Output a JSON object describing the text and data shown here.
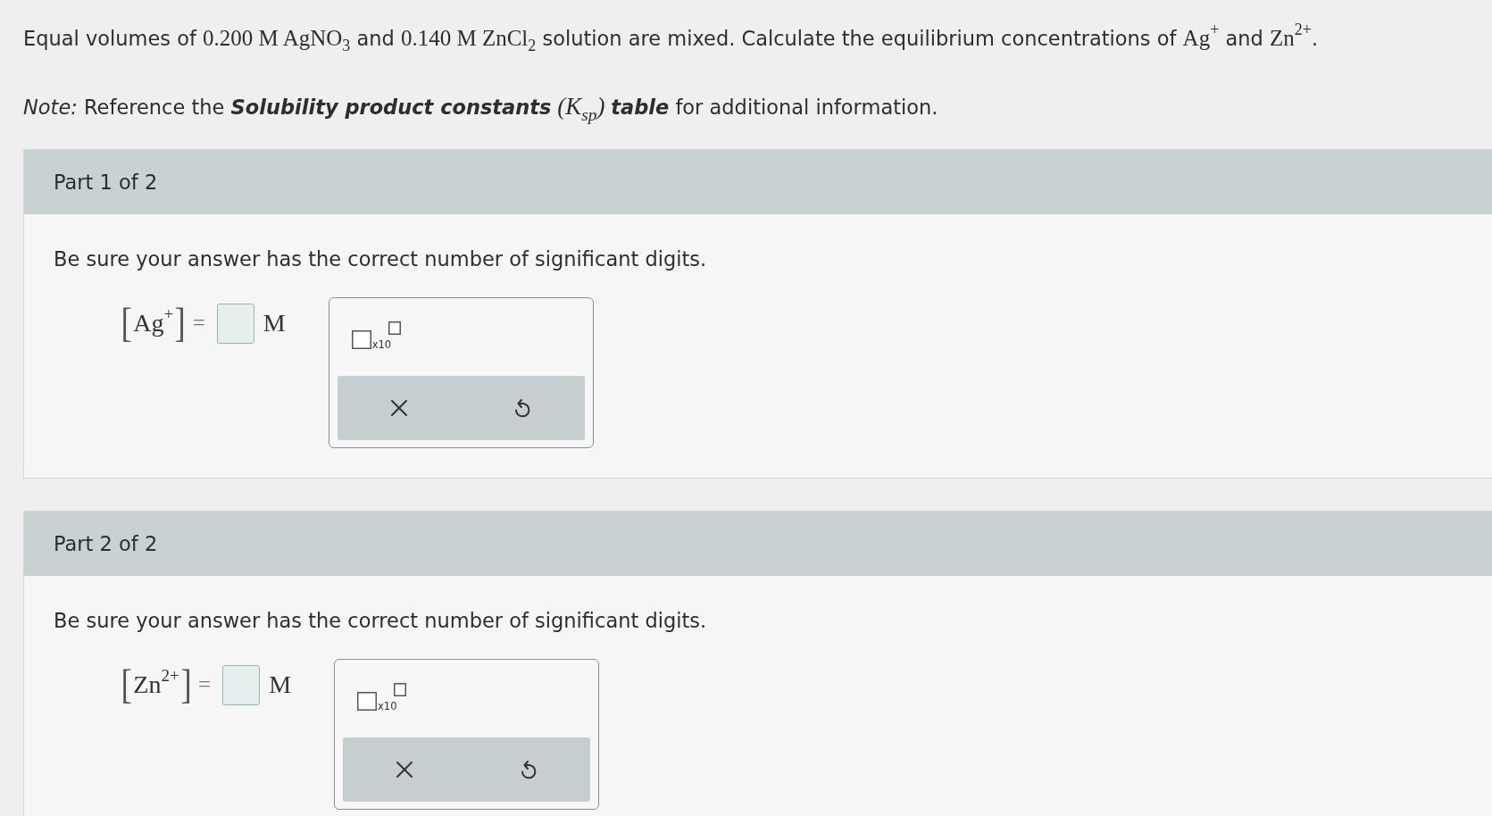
{
  "question": {
    "segments": [
      {
        "kind": "text",
        "text": "Equal volumes of "
      },
      {
        "kind": "math",
        "text": "0.200 M AgNO$_{3}$"
      },
      {
        "kind": "text",
        "text": " and "
      },
      {
        "kind": "math",
        "text": "0.140 M ZnCl$_{2}$"
      },
      {
        "kind": "text",
        "text": " solution are mixed. Calculate the equilibrium concentrations of "
      },
      {
        "kind": "math",
        "text": "Ag$^{+}$"
      },
      {
        "kind": "text",
        "text": " and "
      },
      {
        "kind": "math",
        "text": "Zn$^{2+}$"
      },
      {
        "kind": "text",
        "text": "."
      }
    ]
  },
  "note": {
    "segments": [
      {
        "kind": "text",
        "text": "*Note:* Reference the "
      },
      {
        "kind": "emphasis",
        "text": "Solubility product constants"
      },
      {
        "kind": "math_italic",
        "text": " (K$_{sp}$) "
      },
      {
        "kind": "emphasis",
        "text": "table"
      },
      {
        "kind": "text",
        "text": " for additional information."
      }
    ]
  },
  "parts": [
    {
      "title": "Part 1 of 2",
      "instruction": "Be sure your answer has the correct number of significant digits.",
      "equation": {
        "open": "[",
        "species": "Ag$^{+}$",
        "close": "]",
        "equals": "=",
        "unit": "M"
      },
      "tools": {
        "multiplier": "x10"
      }
    },
    {
      "title": "Part 2 of 2",
      "instruction": "Be sure your answer has the correct number of significant digits.",
      "equation": {
        "open": "[",
        "species": "Zn$^{2+}$",
        "close": "]",
        "equals": "=",
        "unit": "M"
      },
      "tools": {
        "multiplier": "x10"
      }
    }
  ]
}
